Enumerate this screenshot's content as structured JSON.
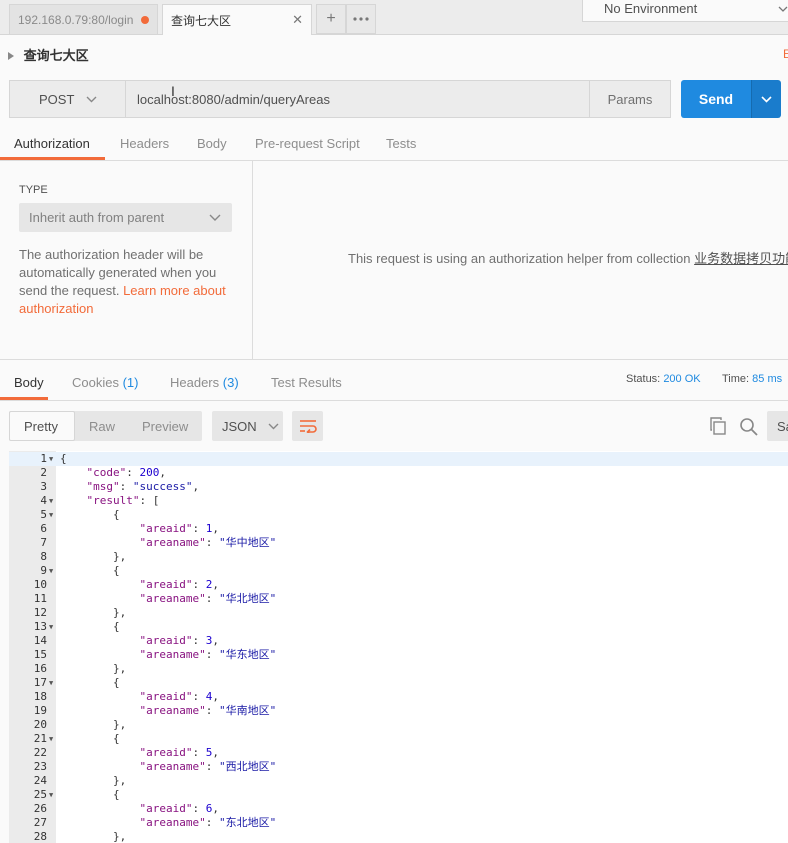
{
  "colors": {
    "accent": "#f26b3a",
    "send": "#1f8ae0",
    "status_value": "#1f8ae0"
  },
  "tabs": [
    {
      "label": "192.168.0.79:80/login",
      "unsaved": true
    },
    {
      "label": "查询七大区",
      "active": true
    }
  ],
  "tab_actions": {
    "new_tab_icon": "plus-icon",
    "more_icon": "ellipsis-icon"
  },
  "environment": {
    "selected": "No Environment"
  },
  "request": {
    "name": "查询七大区",
    "method": "POST",
    "url": "localhost:8080/admin/queryAreas",
    "params_label": "Params",
    "send_label": "Send"
  },
  "request_tabs": [
    "Authorization",
    "Headers",
    "Body",
    "Pre-request Script",
    "Tests"
  ],
  "auth": {
    "type_label": "TYPE",
    "type_value": "Inherit auth from parent",
    "description": "The authorization header will be automatically generated when you send the request. ",
    "learn_more": "Learn more about authorization",
    "helper_text": "This request is using an authorization helper from collection ",
    "collection_name": "业务数据拷贝功能",
    "helper_end": "."
  },
  "response_tabs": [
    {
      "label": "Body",
      "count": ""
    },
    {
      "label": "Cookies",
      "count": "(1)"
    },
    {
      "label": "Headers",
      "count": "(3)"
    },
    {
      "label": "Test Results",
      "count": ""
    }
  ],
  "response_status": {
    "status_label": "Status:",
    "status_value": "200 OK",
    "time_label": "Time:",
    "time_value": "85 ms"
  },
  "response_view": {
    "modes": [
      "Pretty",
      "Raw",
      "Preview"
    ],
    "format": "JSON",
    "save_label": "Save"
  },
  "code_lines": [
    "{",
    "    \"code\": 200,",
    "    \"msg\": \"success\",",
    "    \"result\": [",
    "        {",
    "            \"areaid\": 1,",
    "            \"areaname\": \"华中地区\"",
    "        },",
    "        {",
    "            \"areaid\": 2,",
    "            \"areaname\": \"华北地区\"",
    "        },",
    "        {",
    "            \"areaid\": 3,",
    "            \"areaname\": \"华东地区\"",
    "        },",
    "        {",
    "            \"areaid\": 4,",
    "            \"areaname\": \"华南地区\"",
    "        },",
    "        {",
    "            \"areaid\": 5,",
    "            \"areaname\": \"西北地区\"",
    "        },",
    "        {",
    "            \"areaid\": 6,",
    "            \"areaname\": \"东北地区\"",
    "        },"
  ],
  "foldable_lines": [
    1,
    4,
    5,
    9,
    13,
    17,
    21,
    25
  ]
}
